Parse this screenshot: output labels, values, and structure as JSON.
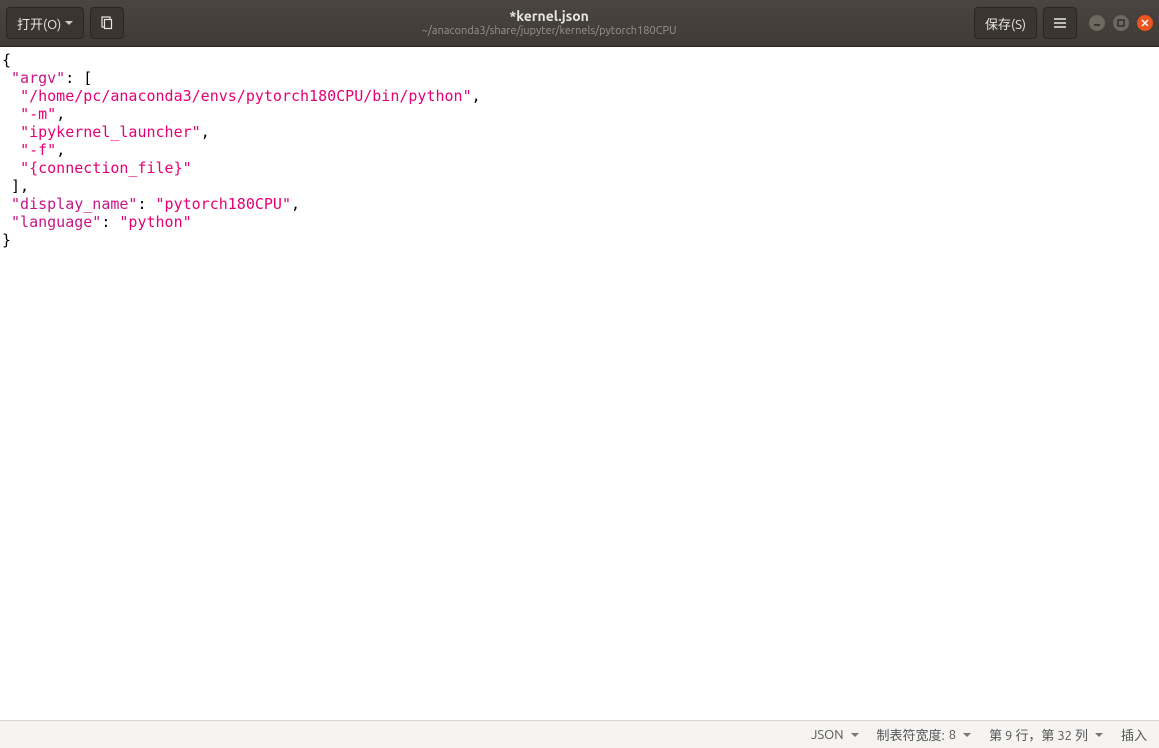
{
  "titlebar": {
    "open_label": "打开(O)",
    "save_label": "保存(S)",
    "title": "*kernel.json",
    "subtitle": "~/anaconda3/share/jupyter/kernels/pytorch180CPU"
  },
  "editor": {
    "lines": [
      {
        "indent": 0,
        "segs": [
          {
            "t": "{",
            "c": "p"
          }
        ]
      },
      {
        "indent": 1,
        "segs": [
          {
            "t": "\"argv\"",
            "c": "k"
          },
          {
            "t": ": [",
            "c": "p"
          }
        ]
      },
      {
        "indent": 2,
        "segs": [
          {
            "t": "\"/home/pc/anaconda3/envs/pytorch180CPU/bin/python\"",
            "c": "s"
          },
          {
            "t": ",",
            "c": "p"
          }
        ]
      },
      {
        "indent": 2,
        "segs": [
          {
            "t": "\"-m\"",
            "c": "s"
          },
          {
            "t": ",",
            "c": "p"
          }
        ]
      },
      {
        "indent": 2,
        "segs": [
          {
            "t": "\"ipykernel_launcher\"",
            "c": "s"
          },
          {
            "t": ",",
            "c": "p"
          }
        ]
      },
      {
        "indent": 2,
        "segs": [
          {
            "t": "\"-f\"",
            "c": "s"
          },
          {
            "t": ",",
            "c": "p"
          }
        ]
      },
      {
        "indent": 2,
        "segs": [
          {
            "t": "\"{connection_file}\"",
            "c": "s"
          }
        ]
      },
      {
        "indent": 1,
        "segs": [
          {
            "t": "],",
            "c": "p"
          }
        ]
      },
      {
        "indent": 1,
        "segs": [
          {
            "t": "\"display_name\"",
            "c": "k"
          },
          {
            "t": ": ",
            "c": "p"
          },
          {
            "t": "\"pytorch180CPU\"",
            "c": "s"
          },
          {
            "t": ",",
            "c": "p"
          }
        ]
      },
      {
        "indent": 1,
        "segs": [
          {
            "t": "\"language\"",
            "c": "k"
          },
          {
            "t": ": ",
            "c": "p"
          },
          {
            "t": "\"python\"",
            "c": "s"
          }
        ]
      },
      {
        "indent": 0,
        "segs": [
          {
            "t": "}",
            "c": "p"
          }
        ]
      }
    ]
  },
  "statusbar": {
    "language": "JSON",
    "tab_label": "制表符宽度:",
    "tab_value": "8",
    "position": "第 9 行，第 32 列",
    "mode": "插入"
  }
}
